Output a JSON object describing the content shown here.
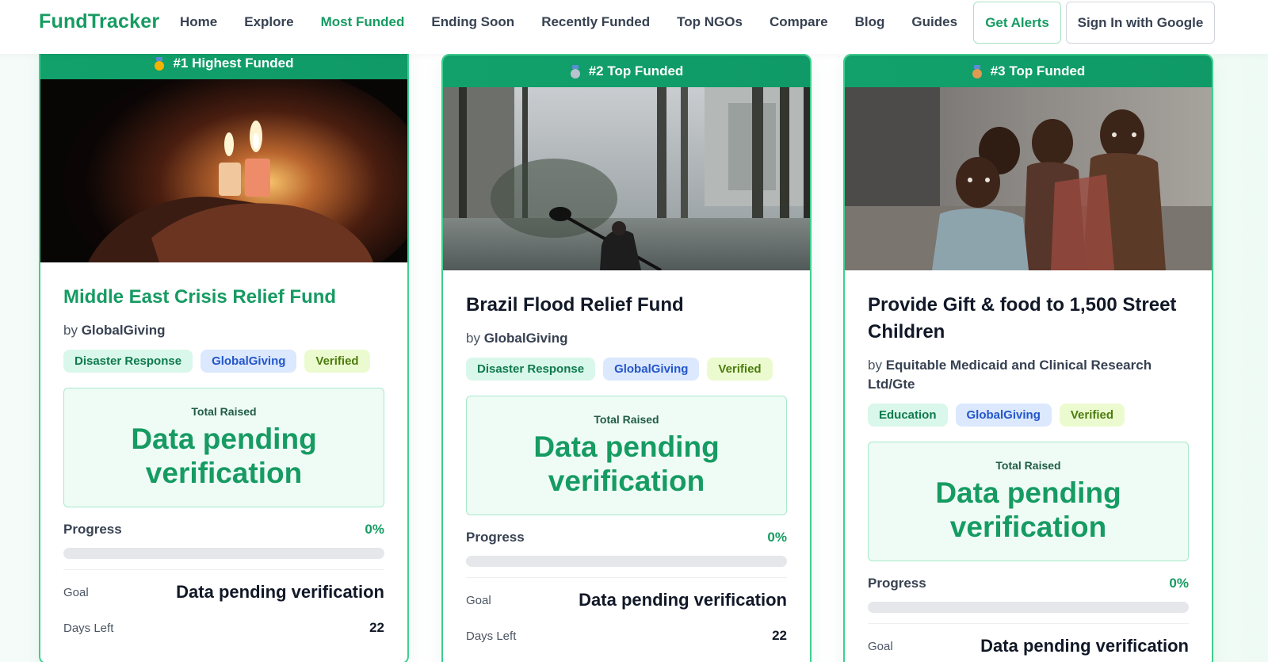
{
  "nav": {
    "logo": "FundTracker",
    "links": [
      "Home",
      "Explore",
      "Most Funded",
      "Ending Soon",
      "Recently Funded",
      "Top NGOs",
      "Compare",
      "Blog",
      "Guides"
    ],
    "active_link": "Most Funded",
    "alerts_label": "Get Alerts",
    "signin_label": "Sign In with Google"
  },
  "colors": {
    "brand": "#169b62",
    "card_border": "#3fcf8e",
    "gold": "#f5b301",
    "silver": "#b9c3cf",
    "bronze": "#e09a52"
  },
  "cards": [
    {
      "banner": "#1 Highest Funded",
      "medal_icon": "gold-medal-icon",
      "title": "Middle East Crisis Relief Fund",
      "by_prefix": "by",
      "organization": "GlobalGiving",
      "tags": [
        "Disaster Response",
        "GlobalGiving",
        "Verified"
      ],
      "raised_label": "Total Raised",
      "raised_value": "Data pending verification",
      "progress_label": "Progress",
      "progress_percent": "0%",
      "progress_fraction": 0,
      "goal_label": "Goal",
      "goal_value": "Data pending verification",
      "days_label": "Days Left",
      "days_value": "22"
    },
    {
      "banner": "#2 Top Funded",
      "medal_icon": "silver-medal-icon",
      "title": "Brazil Flood Relief Fund",
      "by_prefix": "by",
      "organization": "GlobalGiving",
      "tags": [
        "Disaster Response",
        "GlobalGiving",
        "Verified"
      ],
      "raised_label": "Total Raised",
      "raised_value": "Data pending verification",
      "progress_label": "Progress",
      "progress_percent": "0%",
      "progress_fraction": 0,
      "goal_label": "Goal",
      "goal_value": "Data pending verification",
      "days_label": "Days Left",
      "days_value": "22"
    },
    {
      "banner": "#3 Top Funded",
      "medal_icon": "bronze-medal-icon",
      "title": "Provide Gift & food to 1,500 Street Children",
      "by_prefix": "by",
      "organization": "Equitable Medicaid and Clinical Research Ltd/Gte",
      "tags": [
        "Education",
        "GlobalGiving",
        "Verified"
      ],
      "raised_label": "Total Raised",
      "raised_value": "Data pending verification",
      "progress_label": "Progress",
      "progress_percent": "0%",
      "progress_fraction": 0,
      "goal_label": "Goal",
      "goal_value": "Data pending verification"
    }
  ]
}
